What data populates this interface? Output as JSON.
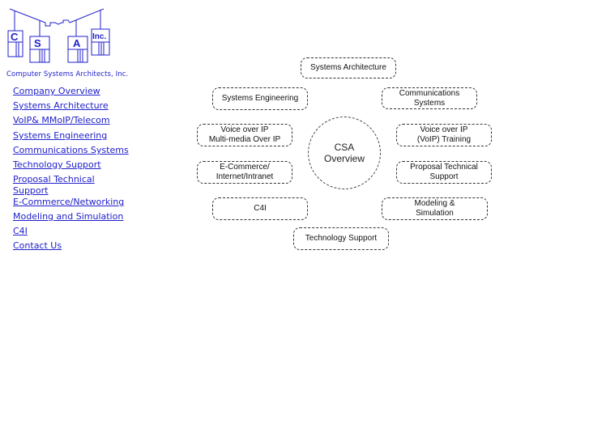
{
  "logo": {
    "letters": [
      "C",
      "S",
      "A",
      "Inc."
    ],
    "caption": "Computer Systems Architects, Inc.",
    "color": "#2222cc"
  },
  "nav": {
    "items": [
      {
        "label": "Company Overview"
      },
      {
        "label": "Systems Architecture"
      },
      {
        "label": "VoIP& MMoIP/Telecom"
      },
      {
        "label": "Systems Engineering"
      },
      {
        "label": "Communications Systems"
      },
      {
        "label": "Technology Support"
      },
      {
        "label": "Proposal Technical\nSupport"
      },
      {
        "label": "E-Commerce/Networking"
      },
      {
        "label": "Modeling and Simulation"
      },
      {
        "label": "C4I"
      },
      {
        "label": "Contact Us"
      }
    ],
    "link_color": "#2020cc"
  },
  "diagram": {
    "hub": "CSA\nOverview",
    "nodes": {
      "systems_architecture": "Systems Architecture",
      "systems_engineering": "Systems Engineering",
      "communications_systems": "Communications\nSystems",
      "voip_mmoip": "Voice over IP\nMulti-media Over IP",
      "voip_training": "Voice over IP\n(VoIP) Training",
      "ecommerce": "E-Commerce/\nInternet/Intranet",
      "proposal_support": "Proposal Technical\nSupport",
      "c4i": "C4I",
      "modeling_simulation": "Modeling &\nSimulation",
      "technology_support": "Technology Support"
    }
  }
}
